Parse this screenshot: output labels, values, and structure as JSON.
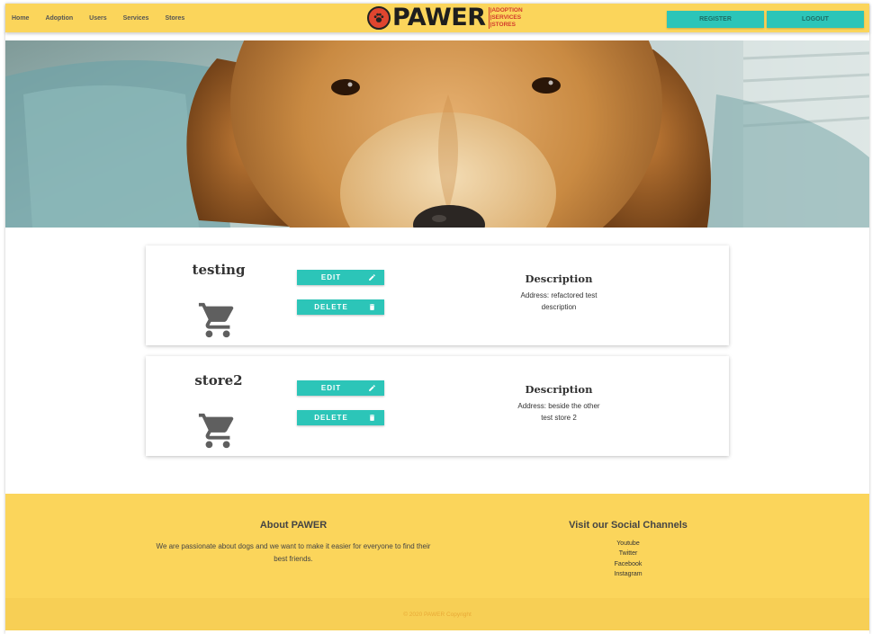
{
  "nav": {
    "links": [
      "Home",
      "Adoption",
      "Users",
      "Services",
      "Stores"
    ],
    "register_label": "REGISTER",
    "logout_label": "LOGOUT"
  },
  "logo": {
    "word": "PAWER",
    "tags": [
      "|ADOPTION",
      "|SERVICES",
      "|STORES"
    ]
  },
  "stores": [
    {
      "name": "testing",
      "edit_label": "EDIT",
      "delete_label": "DELETE",
      "description_title": "Description",
      "description": "Address: refactored test description"
    },
    {
      "name": "store2",
      "edit_label": "EDIT",
      "delete_label": "DELETE",
      "description_title": "Description",
      "description": "Address: beside the other test store 2"
    }
  ],
  "footer": {
    "about_title": "About PAWER",
    "about_text": "We are passionate about dogs and we want to make it easier for everyone to find their best friends.",
    "social_title": "Visit our Social Channels",
    "social_links": [
      "Youtube",
      "Twitter",
      "Facebook",
      "Instagram"
    ],
    "copyright": "© 2020 PAWER Copyright"
  },
  "colors": {
    "accent": "#fbd55b",
    "button": "#2cc5b8",
    "brand_red": "#d33b2c"
  },
  "icons": {
    "cart": "shopping-cart-icon",
    "edit": "pencil-icon",
    "delete": "trash-icon",
    "logo": "paw-icon"
  }
}
